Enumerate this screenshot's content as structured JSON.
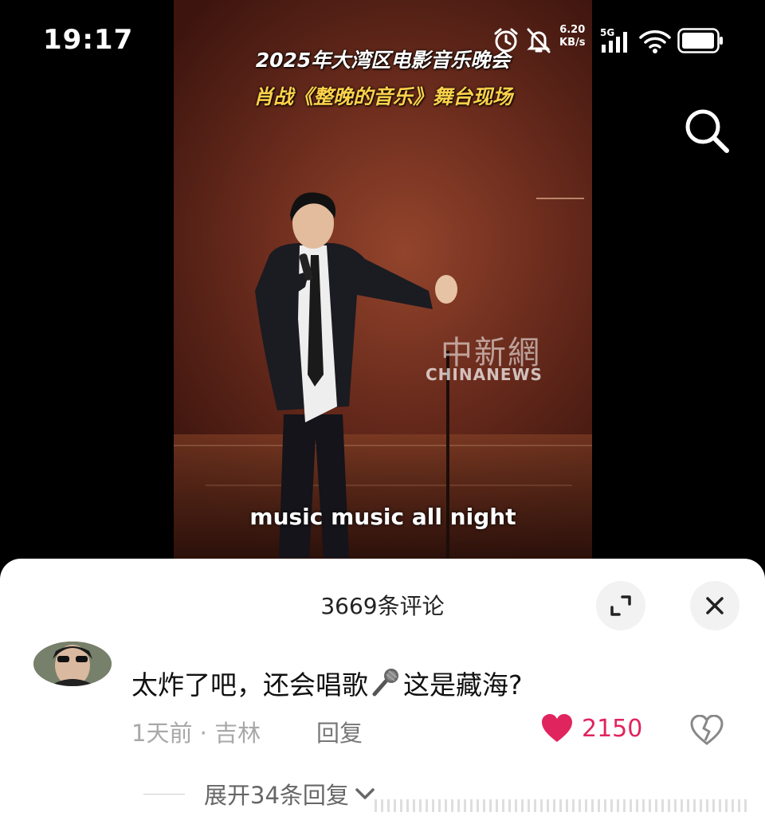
{
  "status_bar": {
    "time": "19:17",
    "net_speed_value": "6.20",
    "net_speed_unit": "KB/s",
    "network_type": "5G",
    "icons": [
      "alarm-icon",
      "mute-icon",
      "signal-icon",
      "wifi-icon",
      "battery-icon"
    ]
  },
  "header": {
    "search_icon": "search-icon"
  },
  "video": {
    "title_line1": "2025年大湾区电影音乐晚会",
    "title_line2": "肖战《整晚的音乐》舞台现场",
    "watermark_cn": "中新網",
    "watermark_en": "CHINANEWS",
    "subtitle": "music music all night"
  },
  "comments_panel": {
    "title": "3669条评论",
    "expand_icon": "expand-icon",
    "close_icon": "close-icon",
    "comment": {
      "text_before_emoji": "太炸了吧，还会唱歌",
      "emoji": "microphone-icon",
      "text_after_emoji": "这是藏海?",
      "meta": "1天前 · 吉林",
      "reply_label": "回复",
      "like_count": "2150",
      "liked": true
    },
    "expand_replies_label": "展开34条回复"
  },
  "colors": {
    "accent_like": "#e0245e",
    "title_yellow": "#ffd24a",
    "panel_bg": "#ffffff"
  }
}
